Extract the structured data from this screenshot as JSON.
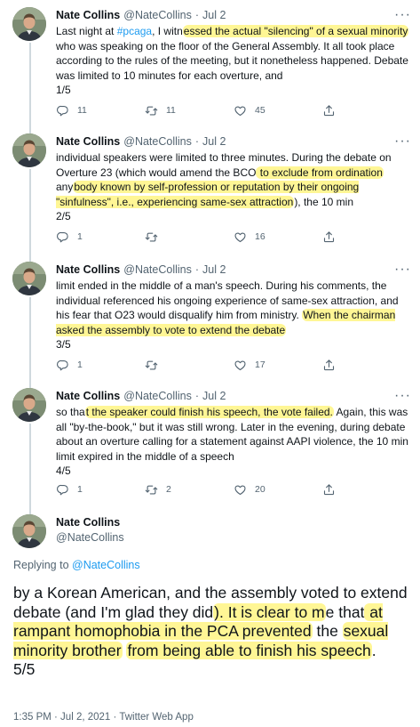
{
  "colors": {
    "highlight": "#fff582",
    "link": "#1d9bf0",
    "secondary_text": "#536471",
    "thread_line": "#cfd9de"
  },
  "author": {
    "name": "Nate Collins",
    "handle": "@NateCollins",
    "date": "Jul 2"
  },
  "tweets": [
    {
      "segments": [
        {
          "t": "Last night at ",
          "k": "plain"
        },
        {
          "t": "#pcaga",
          "k": "link"
        },
        {
          "t": ", I witn",
          "k": "plain"
        },
        {
          "t": "essed the actual \"silencing\" of a sexual minority",
          "k": "hl"
        },
        {
          "t": " who was speaking on the floor of the General Assembly. It all took place according to the rules of the meeting, but it nonetheless happened. Debate was limited to 10 minutes for each overture, and",
          "k": "plain"
        }
      ],
      "counter": "1/5",
      "reply_count": "11",
      "retweet_count": "11",
      "like_count": "45"
    },
    {
      "segments": [
        {
          "t": "individual speakers were limited to three minutes. During the debate on Overture 23 (which would amend the BCO",
          "k": "plain"
        },
        {
          "t": " to exclude from ordination",
          "k": "hl"
        },
        {
          "t": " any",
          "k": "plain"
        },
        {
          "t": "body known by self-profession or reputation by their ongoing \"sinfulness\", i.e., experiencing same-sex attraction",
          "k": "hl"
        },
        {
          "t": "), the 10 min",
          "k": "plain"
        }
      ],
      "counter": "2/5",
      "reply_count": "1",
      "retweet_count": "",
      "like_count": "16"
    },
    {
      "segments": [
        {
          "t": "limit ended in the middle of a man's speech. During his comments, the individual referenced his ongoing experience of same-sex attraction, and his fear that O23 would disqualify him from ministry. ",
          "k": "plain"
        },
        {
          "t": "When the chairman asked the assembly to vote to extend the debate",
          "k": "hl"
        }
      ],
      "counter": "3/5",
      "reply_count": "1",
      "retweet_count": "",
      "like_count": "17"
    },
    {
      "segments": [
        {
          "t": "so tha",
          "k": "plain"
        },
        {
          "t": "t the speaker could finish his speech, the vote failed.",
          "k": "hl"
        },
        {
          "t": " Again, this was all \"by-the-book,\" but it was still wrong. Later in the evening, during debate about an overture calling for a statement against AAPI violence, the 10 min limit expired in the middle of a speech",
          "k": "plain"
        }
      ],
      "counter": "4/5",
      "reply_count": "1",
      "retweet_count": "2",
      "like_count": "20"
    }
  ],
  "main_tweet": {
    "replying_prefix": "Replying to ",
    "replying_handle": "@NateCollins",
    "segments": [
      {
        "t": "by a Korean American, and the assembly voted to extend debate (and I'm glad they did",
        "k": "plain"
      },
      {
        "t": "). It is clear to m",
        "k": "hl"
      },
      {
        "t": "e that",
        "k": "plain"
      },
      {
        "t": " at rampant homophobia in the PCA prevented",
        "k": "hl"
      },
      {
        "t": " the ",
        "k": "plain"
      },
      {
        "t": "sexual minority brother",
        "k": "hl"
      },
      {
        "t": " ",
        "k": "plain"
      },
      {
        "t": "from being able to finish his speech",
        "k": "hl"
      },
      {
        "t": ".",
        "k": "plain"
      }
    ],
    "counter": "5/5",
    "timestamp": "1:35 PM · Jul 2, 2021 · Twitter Web App"
  },
  "icons": [
    "reply-icon",
    "retweet-icon",
    "like-icon",
    "share-icon",
    "more-icon"
  ]
}
